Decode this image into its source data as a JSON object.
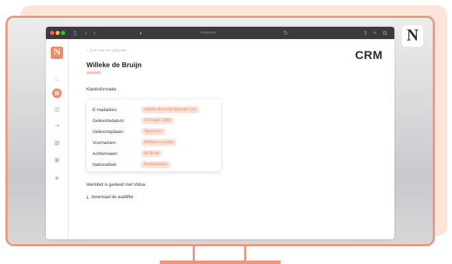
{
  "browser": {
    "url": "notarisoeu"
  },
  "app": {
    "search_placeholder": "Zoek naar een gebruiker...",
    "title": "CRM",
    "logo_letter": "N"
  },
  "client": {
    "name": "Willeke de Bruijn",
    "section_title": "Klantinformatie:",
    "fields": [
      {
        "label": "E-mailadres:",
        "value": "willeke.de.bruijn@gmail.com"
      },
      {
        "label": "Geboortedatum:",
        "value": "10 maart 1965"
      },
      {
        "label": "Geboorteplaats:",
        "value": "Specimen"
      },
      {
        "label": "Voornamen:",
        "value": "Willeke Liselotte"
      },
      {
        "label": "Achternaam:",
        "value": "de Bruin"
      },
      {
        "label": "Nationaliteit:",
        "value": "Nederlandse"
      }
    ],
    "verified_text": "Identiteit is gedeed met Vidua.",
    "download_label": "download de auditfile"
  },
  "badge_letter": "N",
  "colors": {
    "accent": "#f08b69",
    "value_bg": "#fde3d9",
    "monitor_border": "#ef9478"
  }
}
